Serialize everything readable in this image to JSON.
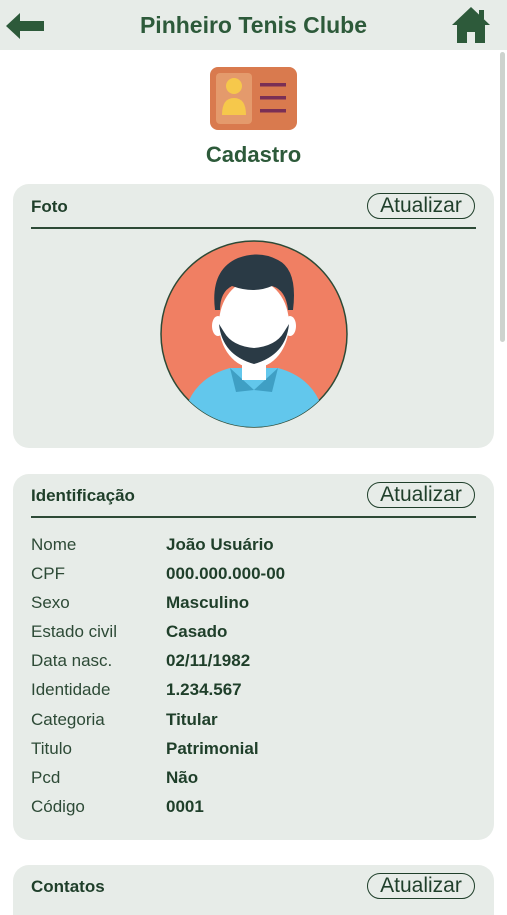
{
  "header": {
    "title": "Pinheiro Tenis Clube",
    "back_icon": "arrow-left-icon",
    "home_icon": "home-icon"
  },
  "page": {
    "icon": "id-card-icon",
    "title": "Cadastro"
  },
  "foto": {
    "title": "Foto",
    "button": "Atualizar",
    "avatar_icon": "user-avatar-icon"
  },
  "identificacao": {
    "title": "Identificação",
    "button": "Atualizar",
    "rows": [
      {
        "label": "Nome",
        "value": "João Usuário"
      },
      {
        "label": "CPF",
        "value": "000.000.000-00"
      },
      {
        "label": "Sexo",
        "value": "Masculino"
      },
      {
        "label": "Estado civil",
        "value": "Casado"
      },
      {
        "label": "Data nasc.",
        "value": "02/11/1982"
      },
      {
        "label": "Identidade",
        "value": "1.234.567"
      },
      {
        "label": "Categoria",
        "value": "Titular"
      },
      {
        "label": "Titulo",
        "value": "Patrimonial"
      },
      {
        "label": "Pcd",
        "value": "Não"
      },
      {
        "label": "Código",
        "value": "0001"
      }
    ]
  },
  "contatos": {
    "title": "Contatos",
    "button": "Atualizar"
  },
  "colors": {
    "primary_green": "#2d5a3a",
    "header_bg": "#e7ece8",
    "card_bg": "#e7ece8",
    "icon_orange": "#d97a4e",
    "avatar_bg": "#f07f63",
    "shirt": "#62c7ec"
  }
}
